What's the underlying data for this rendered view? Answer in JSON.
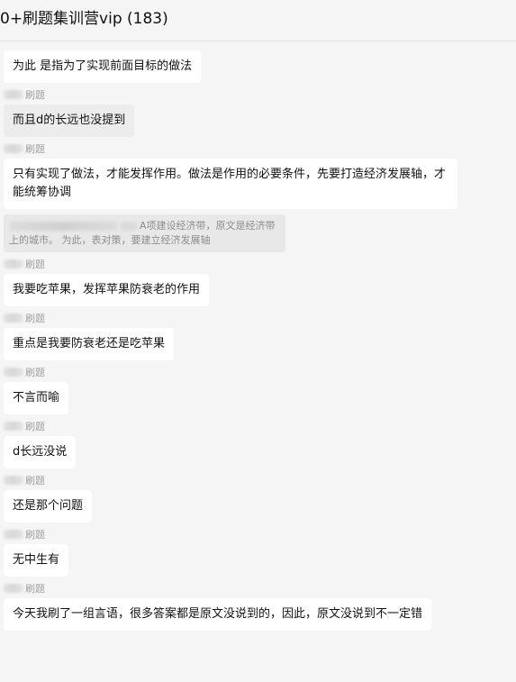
{
  "header": {
    "title": "0+刷题集训营vip (183)"
  },
  "messages": [
    {
      "sender": "",
      "text": "为此 是指为了实现前面目标的做法"
    },
    {
      "sender": "刷题",
      "text": "而且d的长远也没提到"
    },
    {
      "sender": "刷题",
      "text": "只有实现了做法，才能发挥作用。做法是作用的必要条件，先要打造经济发展轴，才能统筹协调"
    },
    {
      "sender": "刷题",
      "text": "我要吃苹果，发挥苹果防衰老的作用"
    },
    {
      "sender": "刷题",
      "text": "重点是我要防衰老还是吃苹果"
    },
    {
      "sender": "刷题",
      "text": "不言而喻"
    },
    {
      "sender": "刷题",
      "text": "d长远没说"
    },
    {
      "sender": "刷题",
      "text": "还是那个问题"
    },
    {
      "sender": "刷题",
      "text": "无中生有"
    },
    {
      "sender": "刷题",
      "text": "今天我刷了一组言语，很多答案都是原文没说到的，因此，原文没说到不一定错"
    }
  ],
  "quote": {
    "line1": "A项建设经济带，原文是经济带",
    "line2": "上的城市。      为此，表对策，要建立经济发展轴"
  }
}
